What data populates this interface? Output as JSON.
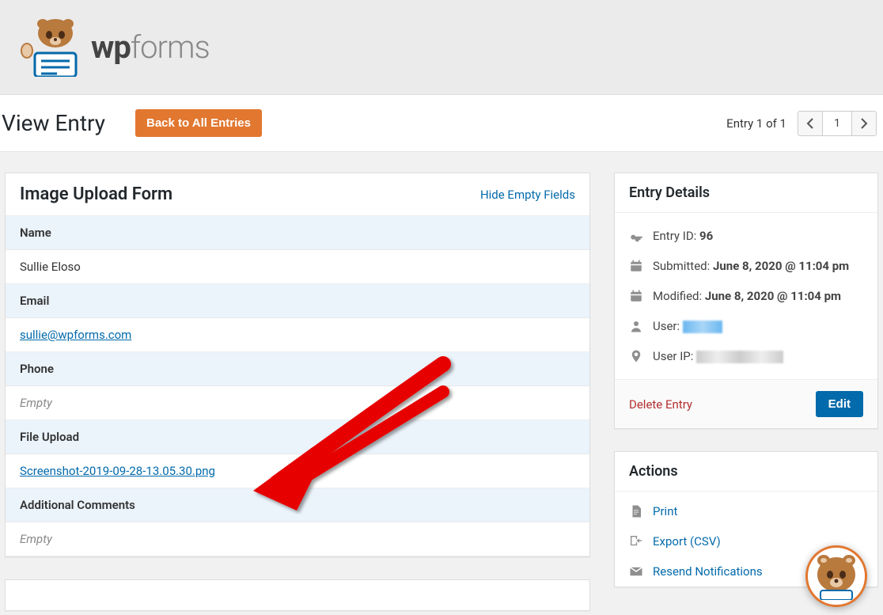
{
  "logo": {
    "text_wp": "wp",
    "text_forms": "forms"
  },
  "titleBar": {
    "heading": "View Entry",
    "backBtn": "Back to All Entries",
    "entryCount": "Entry 1 of 1",
    "pageNum": "1"
  },
  "formPanel": {
    "title": "Image Upload Form",
    "toggleLink": "Hide Empty Fields",
    "fields": {
      "name": {
        "label": "Name",
        "value": "Sullie Eloso"
      },
      "email": {
        "label": "Email",
        "value": "sullie@wpforms.com"
      },
      "phone": {
        "label": "Phone",
        "value": "Empty"
      },
      "file": {
        "label": "File Upload",
        "value": "Screenshot-2019-09-28-13.05.30.png"
      },
      "comments": {
        "label": "Additional Comments",
        "value": "Empty"
      }
    }
  },
  "details": {
    "title": "Entry Details",
    "idLabel": "Entry ID:",
    "idValue": "96",
    "submittedLabel": "Submitted:",
    "submittedValue": "June 8, 2020 @ 11:04 pm",
    "modifiedLabel": "Modified:",
    "modifiedValue": "June 8, 2020 @ 11:04 pm",
    "userLabel": "User:",
    "ipLabel": "User IP:",
    "deleteLink": "Delete Entry",
    "editBtn": "Edit"
  },
  "actions": {
    "title": "Actions",
    "print": "Print",
    "export": "Export (CSV)",
    "resend": "Resend Notifications"
  }
}
